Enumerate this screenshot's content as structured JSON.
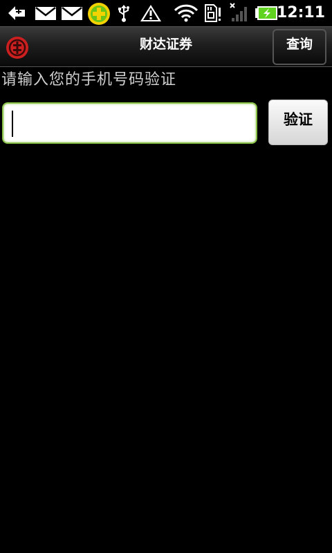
{
  "status_bar": {
    "time": "12:11",
    "icons": [
      "back-arrow-icon",
      "mail-icon",
      "mail-icon",
      "plus-badge-icon",
      "usb-icon",
      "warning-icon",
      "wifi-icon",
      "sd-card-icon",
      "signal-icon",
      "battery-charging-icon"
    ],
    "colors": {
      "badge_green": "#6cc417",
      "badge_yellow": "#f2d200",
      "battery_green": "#5fd31f"
    }
  },
  "title_bar": {
    "logo": "bank-logo-icon",
    "logo_color": "#cc1f1f",
    "title": "财达证券",
    "query_label": "查询"
  },
  "main": {
    "prompt": "请输入您的手机号码验证",
    "phone_input": {
      "value": "",
      "placeholder": ""
    },
    "verify_label": "验证",
    "accent_color": "#8bc34a"
  }
}
